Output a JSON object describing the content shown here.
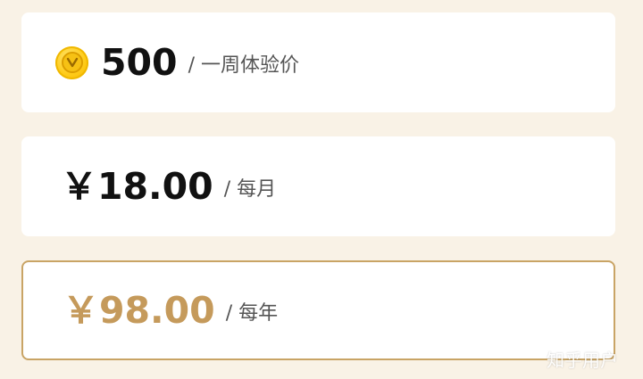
{
  "plans": [
    {
      "price": "500",
      "unit": "/ 一周体验价",
      "icon": "coin-icon"
    },
    {
      "price": "￥18.00",
      "unit": "/ 每月"
    },
    {
      "price": "￥98.00",
      "unit": "/ 每年",
      "selected": true
    }
  ],
  "watermark": "知乎用户",
  "colors": {
    "background": "#f9f2e6",
    "card": "#ffffff",
    "selected_border": "#c9a465",
    "selected_price": "#c59a5b",
    "coin": "#ffcc1a"
  }
}
